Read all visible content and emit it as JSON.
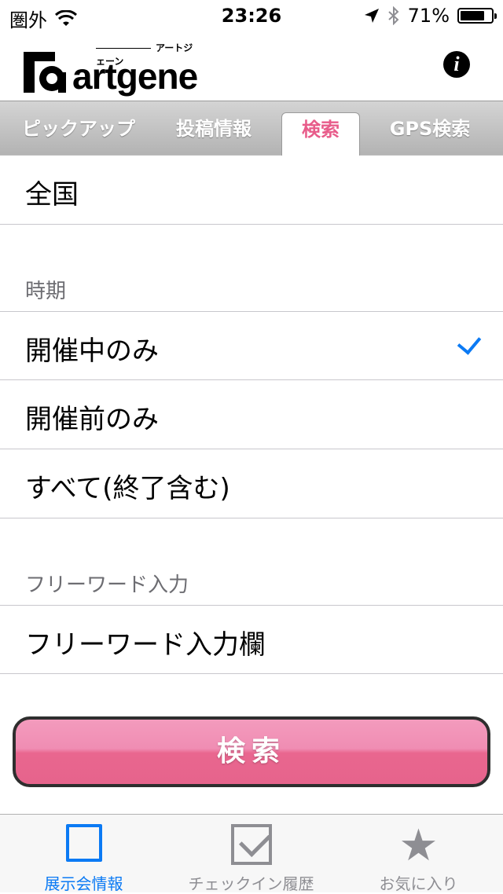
{
  "status": {
    "carrier": "圏外",
    "time": "23:26",
    "battery": "71%",
    "icons": [
      "wifi-icon",
      "location-arrow-icon",
      "bluetooth-icon",
      "battery-icon"
    ]
  },
  "header": {
    "logo_text": "artgene",
    "logo_sub": "アートジェーン",
    "info_icon": "info-icon"
  },
  "tabs": [
    {
      "label": "ピックアップ",
      "active": false
    },
    {
      "label": "投稿情報",
      "active": false
    },
    {
      "label": "検索",
      "active": true
    },
    {
      "label": "GPS検索",
      "active": false
    }
  ],
  "region": {
    "value": "全国"
  },
  "period": {
    "header": "時期",
    "options": [
      {
        "label": "開催中のみ",
        "selected": true
      },
      {
        "label": "開催前のみ",
        "selected": false
      },
      {
        "label": "すべて(終了含む)",
        "selected": false
      }
    ]
  },
  "freeword": {
    "header": "フリーワード入力",
    "field": "フリーワード入力欄"
  },
  "search_button": {
    "label": "検索"
  },
  "bottom_tabs": [
    {
      "label": "展示会情報",
      "icon": "square-icon",
      "active": true
    },
    {
      "label": "チェックイン履歴",
      "icon": "checkbox-icon",
      "active": false
    },
    {
      "label": "お気に入り",
      "icon": "star-icon",
      "active": false
    }
  ],
  "colors": {
    "accent_blue": "#0b7af4",
    "accent_pink": "#e85c8a",
    "inactive_gray": "#8e8e93"
  }
}
